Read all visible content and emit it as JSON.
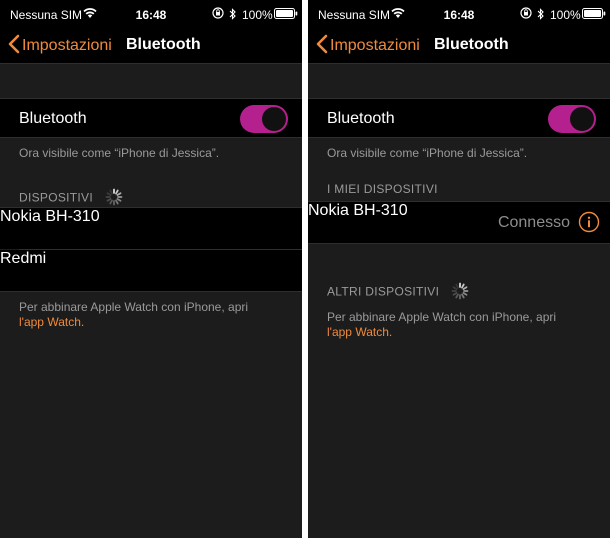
{
  "status_bar": {
    "carrier": "Nessuna SIM",
    "time": "16:48",
    "battery": "100%"
  },
  "nav": {
    "back_label": "Impostazioni",
    "title": "Bluetooth"
  },
  "bluetooth": {
    "label": "Bluetooth",
    "enabled": true,
    "visible_as": "Ora visibile come “iPhone di Jessica”."
  },
  "left_screen": {
    "section_header": "DISPOSITIVI",
    "devices": [
      {
        "name": "Nokia BH-310"
      },
      {
        "name": "Redmi"
      }
    ],
    "footer_text": "Per abbinare Apple Watch con iPhone, apri",
    "footer_link": "l'app Watch."
  },
  "right_screen": {
    "my_devices_header": "I MIEI DISPOSITIVI",
    "my_devices": [
      {
        "name": "Nokia BH-310",
        "status": "Connesso"
      }
    ],
    "other_devices_header": "ALTRI DISPOSITIVI",
    "footer_text": "Per abbinare Apple Watch con iPhone, apri",
    "footer_link": "l'app Watch."
  },
  "colors": {
    "accent": "#f08a3c",
    "toggle_on": "#b4208e",
    "background": "#1c1c1c",
    "cell": "#000000"
  },
  "icons": [
    "wifi-icon",
    "rotation-lock-icon",
    "bluetooth-icon",
    "battery-icon",
    "chevron-left-icon",
    "spinner-icon",
    "info-icon"
  ]
}
